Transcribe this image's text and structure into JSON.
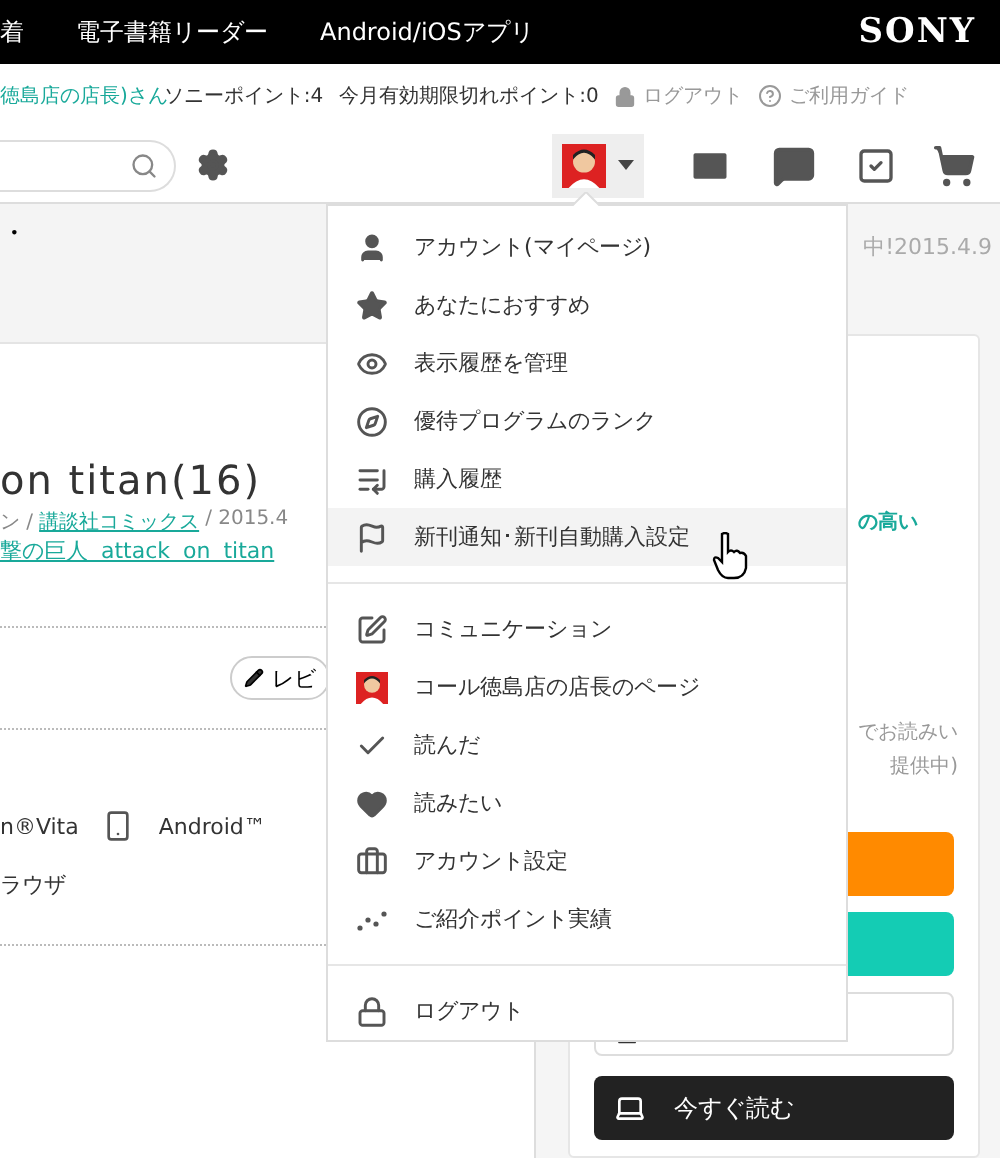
{
  "top_nav": [
    "着",
    "電子書籍リーダー",
    "Android/iOSアプリ"
  ],
  "brand": "SONY",
  "user_bar": {
    "user_name": "徳島店の店長)さん",
    "points": "ソニーポイント:4",
    "expiring": "今月有効期限切れポイント:0",
    "logout": "ログアウト",
    "guide": "ご利用ガイド"
  },
  "header_band": {
    "text": "・",
    "notice": "中!2015.4.9"
  },
  "book": {
    "title": "on titan(16)",
    "meta_prefix": "ン /",
    "publisher": "講談社コミックス",
    "meta_suffix": "/ 2015.4",
    "series": "撃の巨人  attack  on  titan",
    "review_button": "レビ",
    "devices": [
      "n®Vita",
      "Android™"
    ],
    "browser": "ラウザ"
  },
  "side_card": {
    "highlight": "の高い",
    "note_1": "でお読みい",
    "note_2": "提供中)",
    "read_now": "今すぐ読む"
  },
  "account_menu": {
    "groups": [
      [
        {
          "kind": "icon",
          "label": "アカウント(マイページ)",
          "hovered": false
        },
        {
          "kind": "icon",
          "label": "あなたにおすすめ",
          "hovered": false
        },
        {
          "kind": "icon",
          "label": "表示履歴を管理",
          "hovered": false
        },
        {
          "kind": "icon",
          "label": "優待プログラムのランク",
          "hovered": false
        },
        {
          "kind": "icon",
          "label": "購入履歴",
          "hovered": false
        },
        {
          "kind": "icon",
          "label": "新刊通知･新刊自動購入設定",
          "hovered": true
        }
      ],
      [
        {
          "kind": "icon",
          "label": "コミュニケーション",
          "hovered": false
        },
        {
          "kind": "avatar",
          "label": "コール徳島店の店長のページ",
          "hovered": false
        },
        {
          "kind": "icon",
          "label": "読んだ",
          "hovered": false
        },
        {
          "kind": "icon",
          "label": "読みたい",
          "hovered": false
        },
        {
          "kind": "icon",
          "label": "アカウント設定",
          "hovered": false
        },
        {
          "kind": "icon",
          "label": "ご紹介ポイント実績",
          "hovered": false
        }
      ],
      [
        {
          "kind": "icon",
          "label": "ログアウト",
          "hovered": false
        }
      ]
    ]
  }
}
